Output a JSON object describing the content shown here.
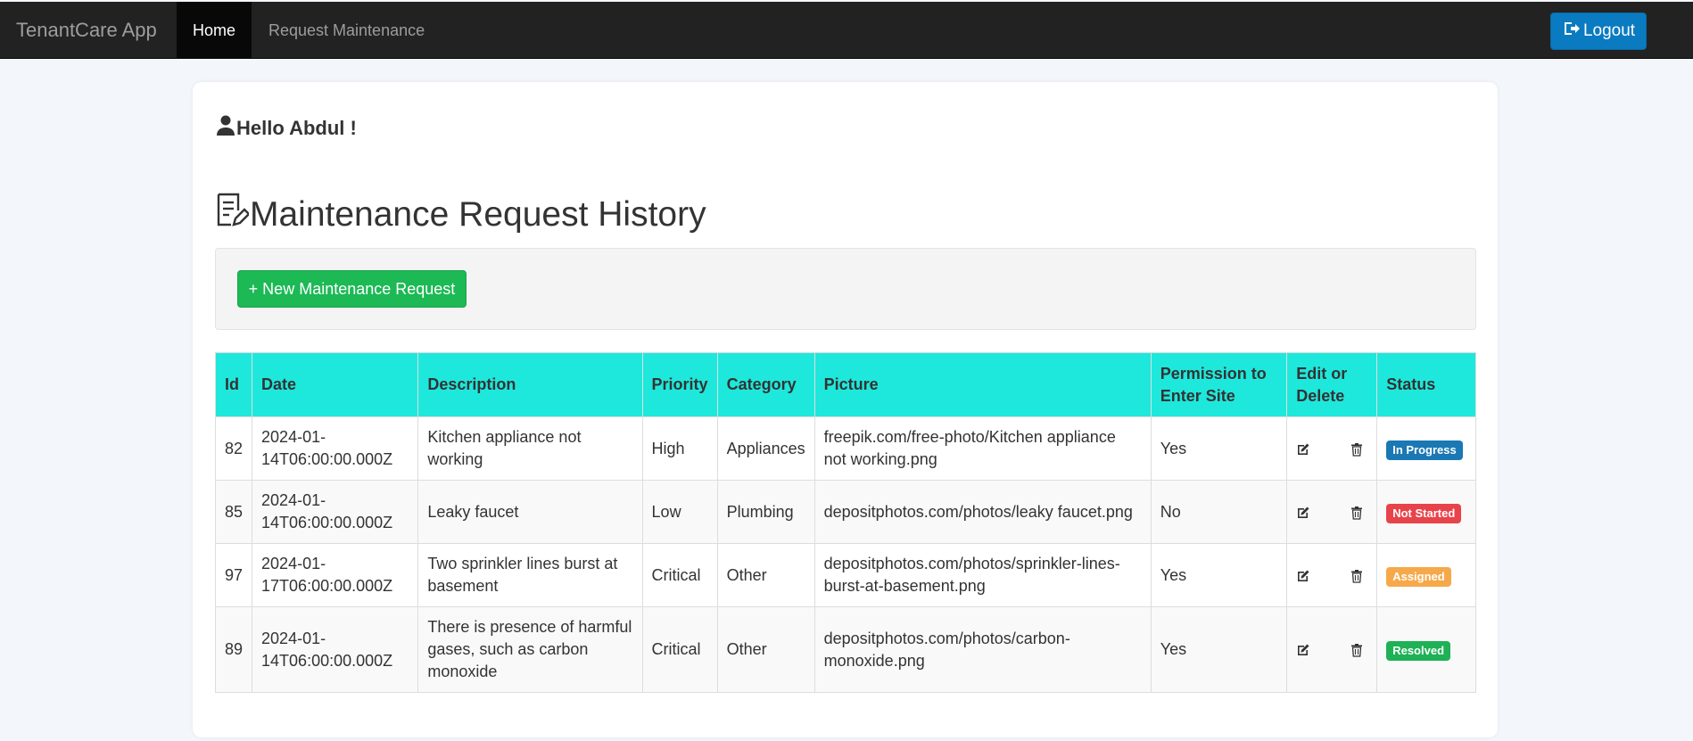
{
  "navbar": {
    "brand": "TenantCare App",
    "home_label": "Home",
    "request_label": "Request Maintenance",
    "logout_label": "Logout"
  },
  "greeting": "Hello Abdul !",
  "page_title": "Maintenance Request History",
  "new_request_label": "+ New Maintenance Request",
  "table": {
    "headers": [
      "Id",
      "Date",
      "Description",
      "Priority",
      "Category",
      "Picture",
      "Permission to Enter Site",
      "Edit or Delete",
      "Status"
    ],
    "rows": [
      {
        "id": "82",
        "date": "2024-01-14T06:00:00.000Z",
        "description": "Kitchen appliance not working",
        "priority": "High",
        "category": "Appliances",
        "picture": "freepik.com/free-photo/Kitchen appliance not working.png",
        "permission": "Yes",
        "status": "In Progress",
        "status_color": "#1a78b4"
      },
      {
        "id": "85",
        "date": "2024-01-14T06:00:00.000Z",
        "description": "Leaky faucet",
        "priority": "Low",
        "category": "Plumbing",
        "picture": "depositphotos.com/photos/leaky faucet.png",
        "permission": "No",
        "status": "Not Started",
        "status_color": "#e8434a"
      },
      {
        "id": "97",
        "date": "2024-01-17T06:00:00.000Z",
        "description": "Two sprinkler lines burst at basement",
        "priority": "Critical",
        "category": "Other",
        "picture": "depositphotos.com/photos/sprinkler-lines-burst-at-basement.png",
        "permission": "Yes",
        "status": "Assigned",
        "status_color": "#f6a94a"
      },
      {
        "id": "89",
        "date": "2024-01-14T06:00:00.000Z",
        "description": "There is presence of harmful gases, such as carbon monoxide",
        "priority": "Critical",
        "category": "Other",
        "picture": "depositphotos.com/photos/carbon-monoxide.png",
        "permission": "Yes",
        "status": "Resolved",
        "status_color": "#1eb155"
      }
    ]
  },
  "colors": {
    "navbar_bg": "#222222",
    "logout_bg": "#0a7bc0",
    "new_button_bg": "#1cb955",
    "table_header_bg": "#1ee8dc"
  },
  "icons": {
    "user": "user-icon",
    "history": "document-edit-icon",
    "logout": "sign-out-icon",
    "edit": "edit-icon",
    "delete": "trash-icon"
  }
}
